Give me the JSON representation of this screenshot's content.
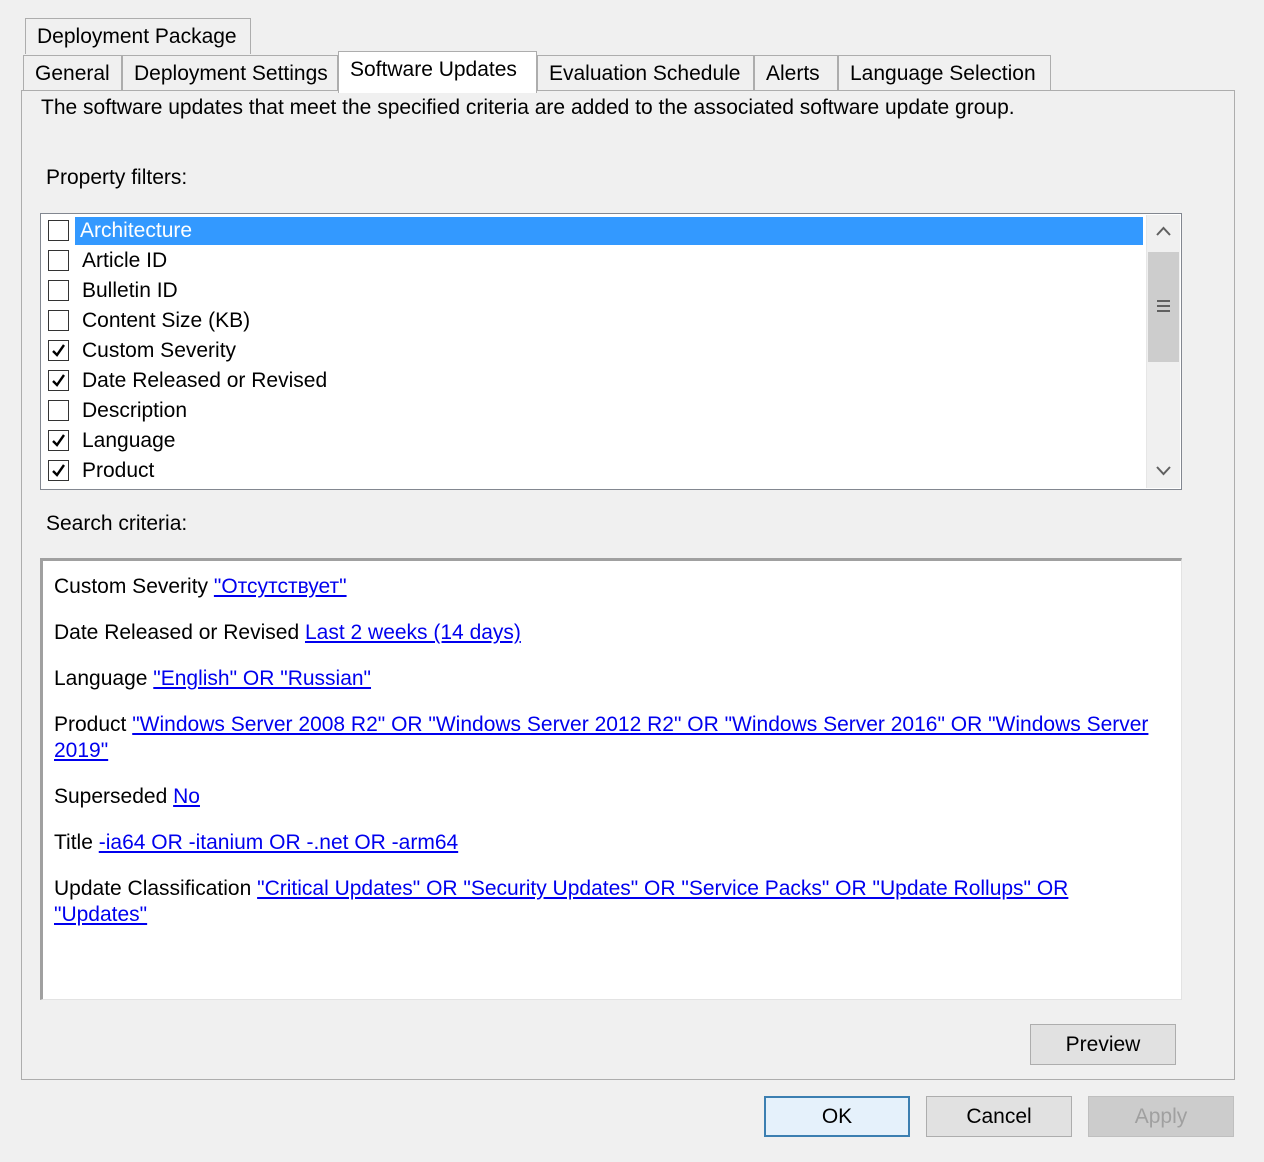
{
  "tabs_top": [
    {
      "label": "Deployment Package"
    }
  ],
  "tabs": [
    {
      "label": "General"
    },
    {
      "label": "Deployment Settings"
    },
    {
      "label": "Software Updates",
      "active": true
    },
    {
      "label": "Evaluation Schedule"
    },
    {
      "label": "Alerts"
    },
    {
      "label": "Language Selection"
    }
  ],
  "panel": {
    "description": "The software updates that meet the specified criteria are added to the associated software update group.",
    "property_filters_label": "Property filters:",
    "search_criteria_label": "Search criteria:"
  },
  "filters": [
    {
      "label": "Architecture",
      "checked": false,
      "selected": true
    },
    {
      "label": "Article ID",
      "checked": false
    },
    {
      "label": "Bulletin ID",
      "checked": false
    },
    {
      "label": "Content Size (KB)",
      "checked": false
    },
    {
      "label": "Custom Severity",
      "checked": true
    },
    {
      "label": "Date Released or Revised",
      "checked": true
    },
    {
      "label": "Description",
      "checked": false
    },
    {
      "label": "Language",
      "checked": true
    },
    {
      "label": "Product",
      "checked": true
    }
  ],
  "criteria": [
    {
      "name": "Custom Severity",
      "value": "\"Отсутствует\""
    },
    {
      "name": "Date Released or Revised",
      "value": "Last 2 weeks (14 days)"
    },
    {
      "name": "Language",
      "value": "\"English\" OR \"Russian\""
    },
    {
      "name": "Product",
      "value": "\"Windows Server 2008 R2\" OR \"Windows Server 2012 R2\" OR \"Windows Server 2016\" OR \"Windows Server 2019\""
    },
    {
      "name": "Superseded",
      "value": "No"
    },
    {
      "name": "Title",
      "value": "-ia64 OR -itanium OR -.net OR -arm64"
    },
    {
      "name": "Update Classification",
      "value": "\"Critical Updates\" OR \"Security Updates\" OR \"Service Packs\" OR \"Update Rollups\" OR \"Updates\""
    }
  ],
  "buttons": {
    "preview": "Preview",
    "ok": "OK",
    "cancel": "Cancel",
    "apply": "Apply"
  },
  "icons": {
    "checkmark": "checkmark-icon",
    "scroll_up": "chevron-up-icon",
    "scroll_down": "chevron-down-icon",
    "grip": "grip-icon"
  },
  "colors": {
    "selection": "#3399ff",
    "link": "#0000ee",
    "dialog_bg": "#f0f0f0"
  }
}
